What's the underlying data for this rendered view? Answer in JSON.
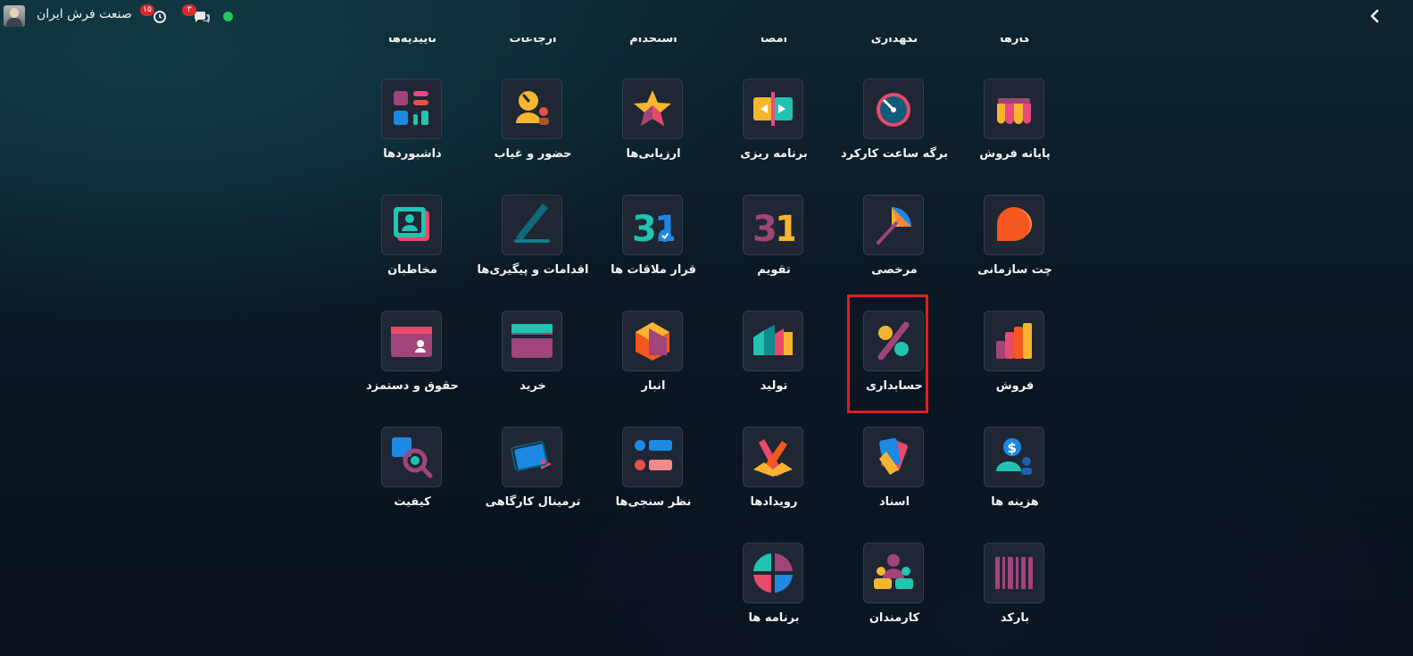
{
  "topbar": {
    "company_name": "صنعت فرش ایران",
    "activity_badge": "۱۵",
    "messages_badge": "۳",
    "status_color": "#21c65f",
    "icons": [
      "avatar",
      "activity-clock-icon",
      "chat-bubbles-icon",
      "back-chevron-icon"
    ]
  },
  "partial_row": [
    "کارها",
    "نگهداری",
    "امضا",
    "استخدام",
    "ارجاعات",
    "تاییدیه‌ها"
  ],
  "apps": [
    {
      "label": "پایانه فروش",
      "icon": "shop-awning-icon"
    },
    {
      "label": "برگه ساعت کارکرد",
      "icon": "timer-icon"
    },
    {
      "label": "برنامه ریزی",
      "icon": "planning-icon"
    },
    {
      "label": "ارزیابی‌ها",
      "icon": "star-icon"
    },
    {
      "label": "حضور و غیاب",
      "icon": "attendance-icon"
    },
    {
      "label": "داشبوردها",
      "icon": "dashboard-icon"
    },
    {
      "label": "چت سازمانی",
      "icon": "chat-bubble-icon"
    },
    {
      "label": "مرخصی",
      "icon": "umbrella-icon"
    },
    {
      "label": "تقویم",
      "icon": "calendar-icon",
      "text": "31"
    },
    {
      "label": "قرار ملاقات ها",
      "icon": "appointment-icon",
      "text": "31"
    },
    {
      "label": "اقدامات و پیگیری‌ها",
      "icon": "pen-icon"
    },
    {
      "label": "مخاطبان",
      "icon": "contacts-icon"
    },
    {
      "label": "فروش",
      "icon": "sales-chart-icon"
    },
    {
      "label": "حسابداری",
      "icon": "percent-icon"
    },
    {
      "label": "تولید",
      "icon": "factory-icon"
    },
    {
      "label": "انبار",
      "icon": "box-icon"
    },
    {
      "label": "خرید",
      "icon": "purchase-card-icon"
    },
    {
      "label": "حقوق و دستمزد",
      "icon": "payroll-icon"
    },
    {
      "label": "هزینه ها",
      "icon": "expenses-icon"
    },
    {
      "label": "اسناد",
      "icon": "documents-icon"
    },
    {
      "label": "رویدادها",
      "icon": "events-icon"
    },
    {
      "label": "نظر سنجی‌ها",
      "icon": "surveys-icon"
    },
    {
      "label": "ترمینال کارگاهی",
      "icon": "shopfloor-icon"
    },
    {
      "label": "کیفیت",
      "icon": "quality-magnifier-icon"
    },
    {
      "label": "بارکد",
      "icon": "barcode-icon"
    },
    {
      "label": "کارمندان",
      "icon": "employees-icon"
    },
    {
      "label": "برنامه ها",
      "icon": "apps-icon"
    }
  ],
  "highlighted_app": "حسابداری"
}
